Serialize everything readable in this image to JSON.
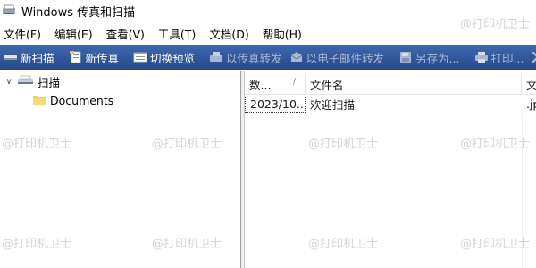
{
  "window": {
    "title": "Windows 传真和扫描"
  },
  "menu": [
    {
      "label": "文件(F)"
    },
    {
      "label": "编辑(E)"
    },
    {
      "label": "查看(V)"
    },
    {
      "label": "工具(T)"
    },
    {
      "label": "文档(D)"
    },
    {
      "label": "帮助(H)"
    }
  ],
  "toolbar": {
    "new_scan": "新扫描",
    "new_fax": "新传真",
    "toggle_preview": "切换预览",
    "forward_as_fax": "以传真转发",
    "forward_as_email": "以电子邮件转发",
    "save_as": "另存为...",
    "print": "打印..."
  },
  "tree": {
    "root_label": "扫描",
    "child_label": "Documents"
  },
  "list": {
    "headers": [
      "数...",
      "文件名",
      "文"
    ],
    "rows": [
      {
        "date": "2023/10...",
        "filename": "欢迎扫描",
        "ext": ".jp"
      }
    ]
  },
  "watermark": "@打印机卫士",
  "colors": {
    "toolbar_top": "#3f69ad",
    "toolbar_bottom": "#25498a",
    "folder": "#f4cf5b"
  }
}
